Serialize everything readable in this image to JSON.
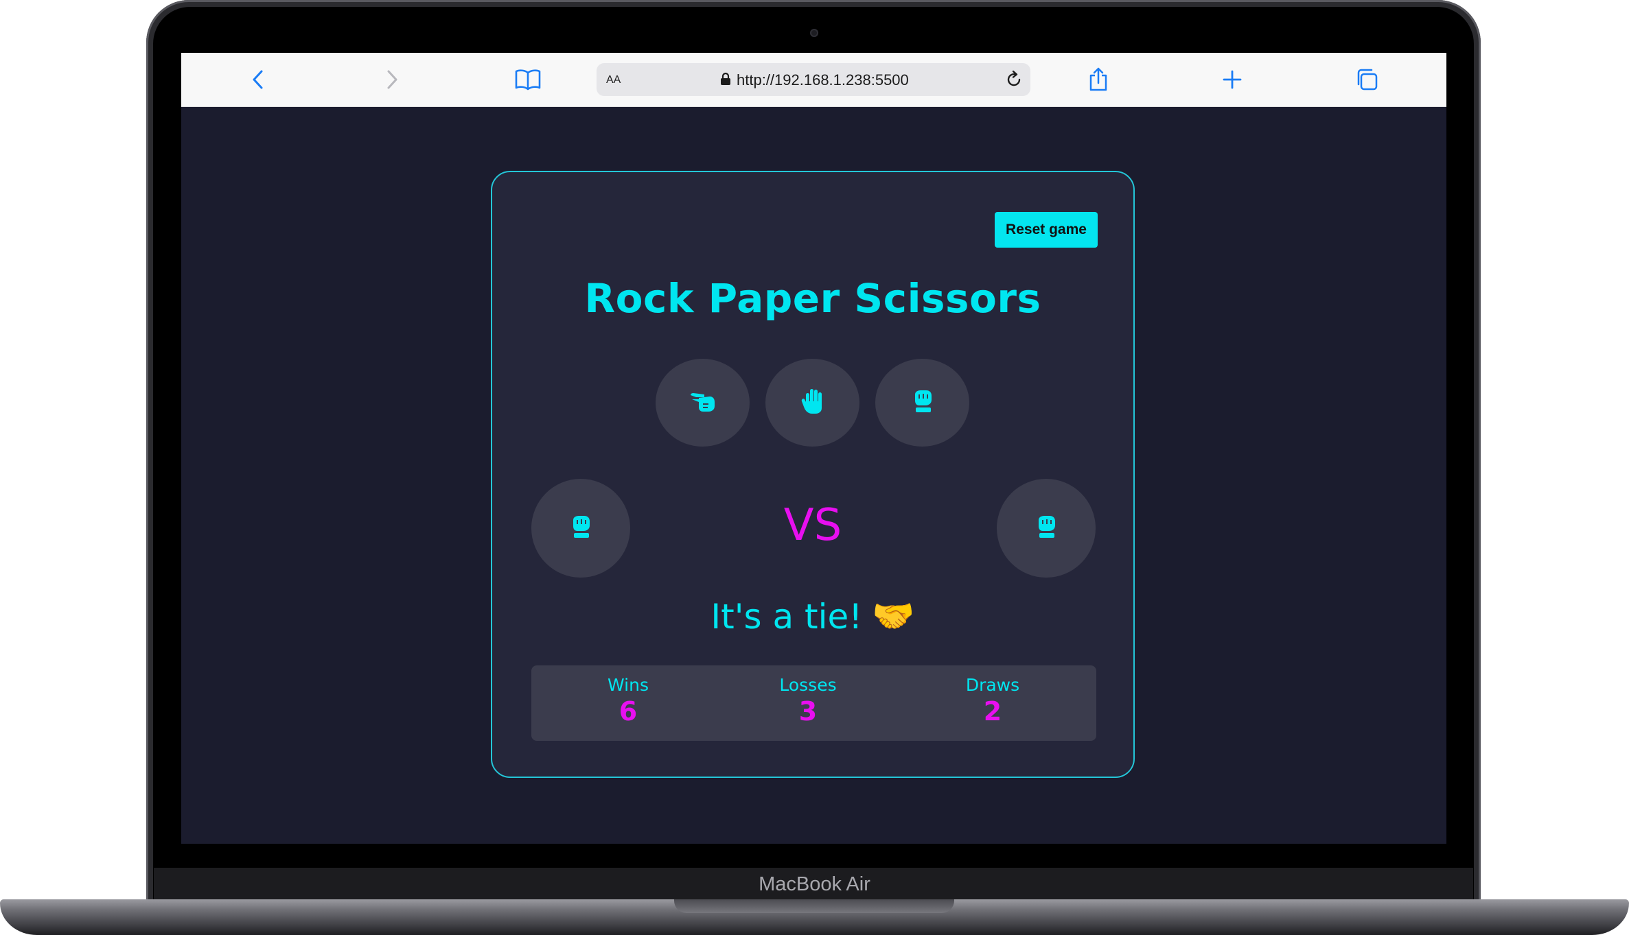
{
  "device": {
    "label": "MacBook Air"
  },
  "browser": {
    "text_size_label": "AA",
    "url": "http://192.168.1.238:5500",
    "icons": {
      "back": "chevron-left-icon",
      "forward": "chevron-right-icon",
      "bookmarks": "book-icon",
      "lock": "lock-icon",
      "reload": "reload-icon",
      "share": "share-icon",
      "new_tab": "plus-icon",
      "tabs": "tabs-icon"
    },
    "accent_color": "#1a7cf5"
  },
  "game": {
    "reset_label": "Reset game",
    "title": "Rock Paper Scissors",
    "choices": [
      {
        "name": "scissors",
        "icon": "hand-scissors-icon"
      },
      {
        "name": "paper",
        "icon": "hand-paper-icon"
      },
      {
        "name": "rock",
        "icon": "hand-rock-icon"
      }
    ],
    "player_pick_icon": "hand-rock-icon",
    "computer_pick_icon": "hand-rock-icon",
    "vs_label": "VS",
    "result_text": "It's a tie!",
    "result_emoji": "🤝",
    "scores": [
      {
        "label": "Wins",
        "value": "6"
      },
      {
        "label": "Losses",
        "value": "3"
      },
      {
        "label": "Draws",
        "value": "2"
      }
    ],
    "colors": {
      "background": "#1b1c2e",
      "card": "#25263a",
      "primary": "#00e6f0",
      "secondary": "#e80ff0",
      "circle": "#3b3c4d"
    }
  }
}
